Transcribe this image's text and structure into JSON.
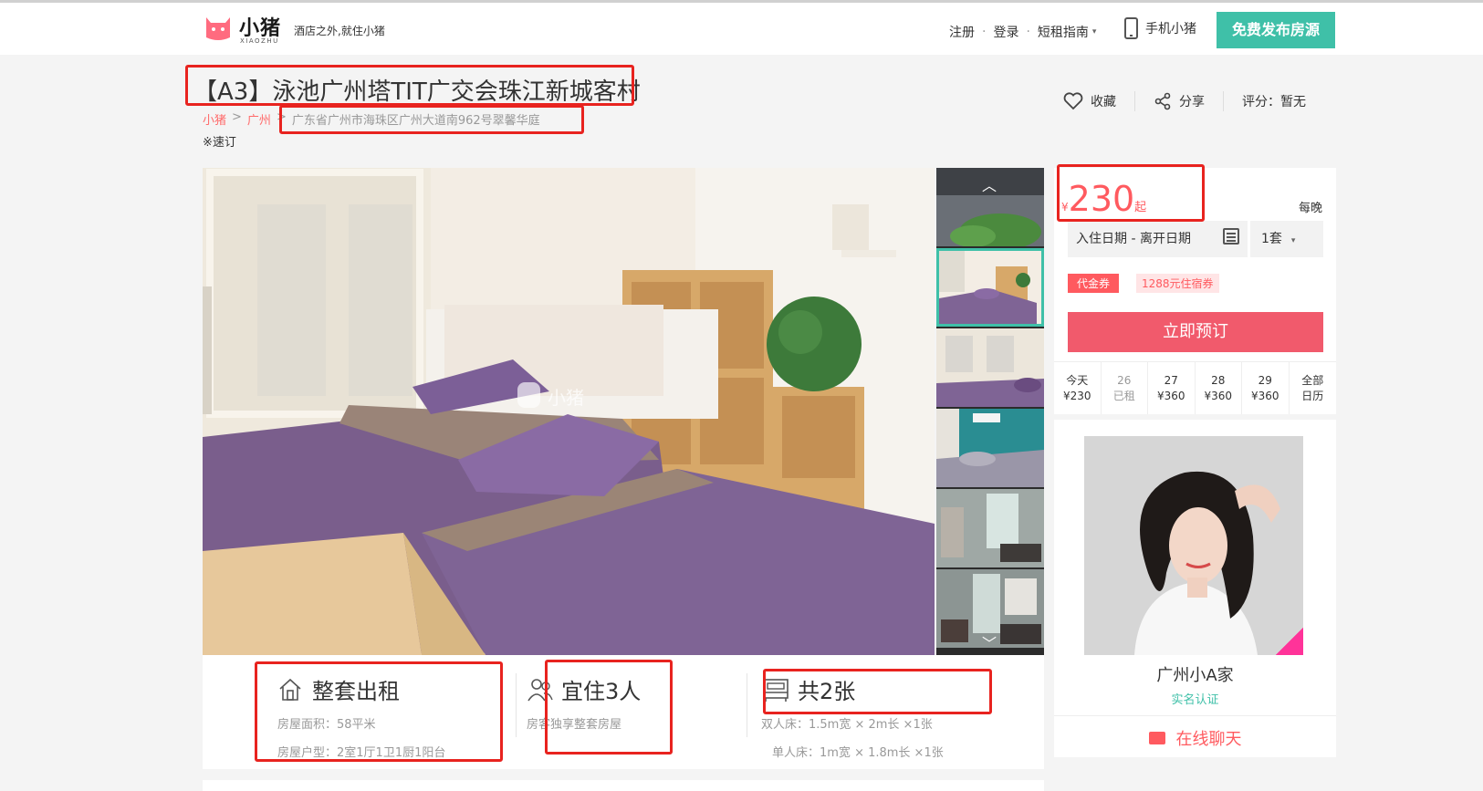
{
  "header": {
    "logo_text": "小猪",
    "logo_sub": "XIAOZHU",
    "slogan": "酒店之外,就住小猪",
    "nav_register": "注册",
    "nav_login": "登录",
    "nav_guide": "短租指南",
    "nav_mobile": "手机小猪",
    "publish_button": "免费发布房源"
  },
  "listing": {
    "title": "【A3】泳池广州塔TIT广交会珠江新城客村",
    "breadcrumb": [
      "小猪",
      "广州"
    ],
    "address": "广东省广州市海珠区广州大道南962号翠馨华庭",
    "quick_book": "※速订",
    "actions": {
      "favorite": "收藏",
      "share": "分享",
      "rating": "评分：暂无"
    }
  },
  "gallery": {
    "watermark": "小猪"
  },
  "info": {
    "type_title": "整套出租",
    "area": "房屋面积：58平米",
    "layout": "房屋户型：2室1厅1卫1厨1阳台",
    "guests_title": "宜住3人",
    "guests_note": "房客独享整套房屋",
    "beds_title": "共2张",
    "bed1": "双人床：1.5m宽 × 2m长 ×1张",
    "bed2": "单人床：1m宽 × 1.8m长 ×1张"
  },
  "booking": {
    "currency": "¥",
    "price": "230",
    "price_suffix": "起",
    "per_night": "每晚",
    "date_placeholder": "入住日期 - 离开日期",
    "quantity": "1套",
    "coupon_tag": "代金券",
    "coupon_text": "1288元住宿券",
    "book_button": "立即预订",
    "calendar": [
      {
        "day": "今天",
        "price": "¥230",
        "state": "available"
      },
      {
        "day": "26",
        "price": "已租",
        "state": "rented"
      },
      {
        "day": "27",
        "price": "¥360",
        "state": "available"
      },
      {
        "day": "28",
        "price": "¥360",
        "state": "available"
      },
      {
        "day": "29",
        "price": "¥360",
        "state": "available"
      },
      {
        "day": "全部",
        "price": "日历",
        "state": "link"
      }
    ]
  },
  "host": {
    "name": "广州小A家",
    "verification": "实名认证",
    "chat": "在线聊天"
  },
  "colors": {
    "brand_teal": "#3fc0a8",
    "accent_red": "#ff5a5f",
    "book_button": "#f15a6c",
    "annotation_red": "#e8231f"
  }
}
